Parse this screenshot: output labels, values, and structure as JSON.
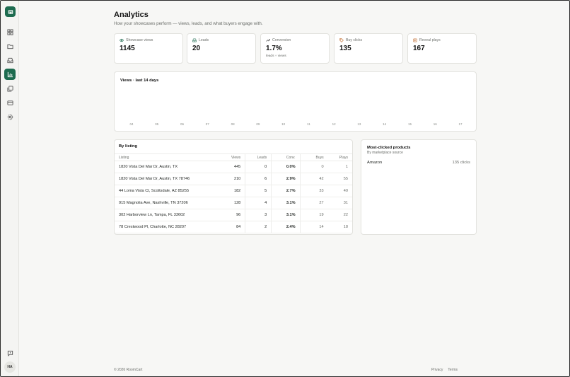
{
  "app": {
    "name": "RoomCart",
    "avatar_initials": "HA"
  },
  "sidebar": {
    "items": [
      {
        "name": "dashboard",
        "icon": "grid-icon",
        "active": false
      },
      {
        "name": "listings",
        "icon": "folder-icon",
        "active": false
      },
      {
        "name": "inbox",
        "icon": "inbox-icon",
        "active": false
      },
      {
        "name": "analytics",
        "icon": "bar-chart-icon",
        "active": true
      },
      {
        "name": "gallery",
        "icon": "images-icon",
        "active": false
      },
      {
        "name": "billing",
        "icon": "credit-card-icon",
        "active": false
      },
      {
        "name": "settings",
        "icon": "gear-icon",
        "active": false
      }
    ],
    "feedback_icon": "message-icon"
  },
  "page": {
    "title": "Analytics",
    "subtitle": "How your showcases perform — views, leads, and what buyers engage with."
  },
  "stats": [
    {
      "label": "Showcase views",
      "value": "1145",
      "icon": "eye-icon",
      "sub": ""
    },
    {
      "label": "Leads",
      "value": "20",
      "icon": "inbox-icon",
      "sub": ""
    },
    {
      "label": "Conversion",
      "value": "1.7%",
      "icon": "trend-up-icon",
      "sub": "leads ÷ views"
    },
    {
      "label": "Buy clicks",
      "value": "135",
      "icon": "tag-icon",
      "sub": ""
    },
    {
      "label": "Reveal plays",
      "value": "167",
      "icon": "play-icon",
      "sub": ""
    }
  ],
  "chart_data": {
    "type": "bar",
    "title": "Views · last 14 days",
    "categories": [
      "04",
      "05",
      "06",
      "07",
      "08",
      "09",
      "10",
      "11",
      "12",
      "13",
      "14",
      "15",
      "16",
      "17"
    ],
    "values": [
      0,
      0,
      0,
      0,
      0,
      0,
      0,
      0,
      0,
      0,
      0,
      0,
      0,
      0
    ],
    "xlabel": "",
    "ylabel": ""
  },
  "table": {
    "title": "By listing",
    "columns": [
      "Listing",
      "Views",
      "Leads",
      "Conv.",
      "Buys",
      "Plays"
    ],
    "rows": [
      {
        "listing": "1820 Vista Del Mar Dr, Austin, TX",
        "views": "445",
        "leads": "0",
        "conv": "0.0%",
        "buys": "0",
        "plays": "1"
      },
      {
        "listing": "1820 Vista Del Mar Dr, Austin, TX 78746",
        "views": "210",
        "leads": "6",
        "conv": "2.9%",
        "buys": "42",
        "plays": "55"
      },
      {
        "listing": "44 Loma Vista Ct, Scottsdale, AZ 85255",
        "views": "182",
        "leads": "5",
        "conv": "2.7%",
        "buys": "33",
        "plays": "40"
      },
      {
        "listing": "915 Magnolia Ave, Nashville, TN 37206",
        "views": "128",
        "leads": "4",
        "conv": "3.1%",
        "buys": "27",
        "plays": "31"
      },
      {
        "listing": "302 Harborview Ln, Tampa, FL 33602",
        "views": "96",
        "leads": "3",
        "conv": "3.1%",
        "buys": "19",
        "plays": "22"
      },
      {
        "listing": "78 Crestwood Pl, Charlotte, NC 28207",
        "views": "84",
        "leads": "2",
        "conv": "2.4%",
        "buys": "14",
        "plays": "18"
      }
    ]
  },
  "products": {
    "title": "Most-clicked products",
    "subtitle": "By marketplace source",
    "items": [
      {
        "source": "Amazon",
        "clicks": "135 clicks"
      }
    ]
  },
  "footer": {
    "copyright": "© 2026 RoomCart",
    "links": [
      "Privacy",
      "Terms"
    ]
  },
  "colors": {
    "accent": "#1d6b4f",
    "bg": "#f7f7f5",
    "card": "#ffffff",
    "muted": "#6b6e6a"
  }
}
